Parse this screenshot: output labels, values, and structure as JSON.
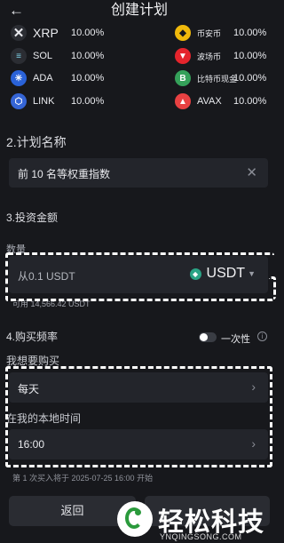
{
  "header": {
    "back_glyph": "←",
    "title": "创建计划"
  },
  "coins": [
    {
      "name": "XRP",
      "pct": "10.00%",
      "icon": "xrp-icon",
      "color": "#2b2d33"
    },
    {
      "name": "币安币",
      "pct": "10.00%",
      "icon": "bnb-icon",
      "color": "#f0b90b"
    },
    {
      "name": "SOL",
      "pct": "10.00%",
      "icon": "sol-icon",
      "color": "#2b2d33"
    },
    {
      "name": "波场币",
      "pct": "10.00%",
      "icon": "trx-icon",
      "color": "#e5242c"
    },
    {
      "name": "ADA",
      "pct": "10.00%",
      "icon": "ada-icon",
      "color": "#2a62d8"
    },
    {
      "name": "比特币现金",
      "pct": "10.00%",
      "icon": "bch-icon",
      "color": "#35a15a"
    },
    {
      "name": "LINK",
      "pct": "10.00%",
      "icon": "link-icon",
      "color": "#3565d6"
    },
    {
      "name": "AVAX",
      "pct": "10.00%",
      "icon": "avax-icon",
      "color": "#e84142"
    }
  ],
  "plan_name": {
    "label": "2.计划名称",
    "value": "前 10 名等权重指数",
    "clear_glyph": "✕"
  },
  "investment": {
    "label": "3.投资金额",
    "quantity_label": "数量",
    "placeholder": "从0.1 USDT",
    "currency": "USDT",
    "available": "可用 14,566.42 USDT"
  },
  "frequency": {
    "label": "4.购买频率",
    "once_label": "一次性",
    "once_enabled": false,
    "want_to_buy_label": "我想要购买",
    "period_value": "每天",
    "local_time_label": "在我的本地时间",
    "time_value": "16:00",
    "next_buy": "第 1 次买入将于 2025-07-25 16:00 开始"
  },
  "buttons": {
    "back_label": "返回"
  },
  "watermark": {
    "brand": "轻松科技",
    "site": "YNQINGSONG.COM"
  },
  "colors": {
    "background": "#17181c",
    "field": "#23252b",
    "usdt_green": "#2aa385",
    "watermark_green": "#2a9a3c"
  }
}
